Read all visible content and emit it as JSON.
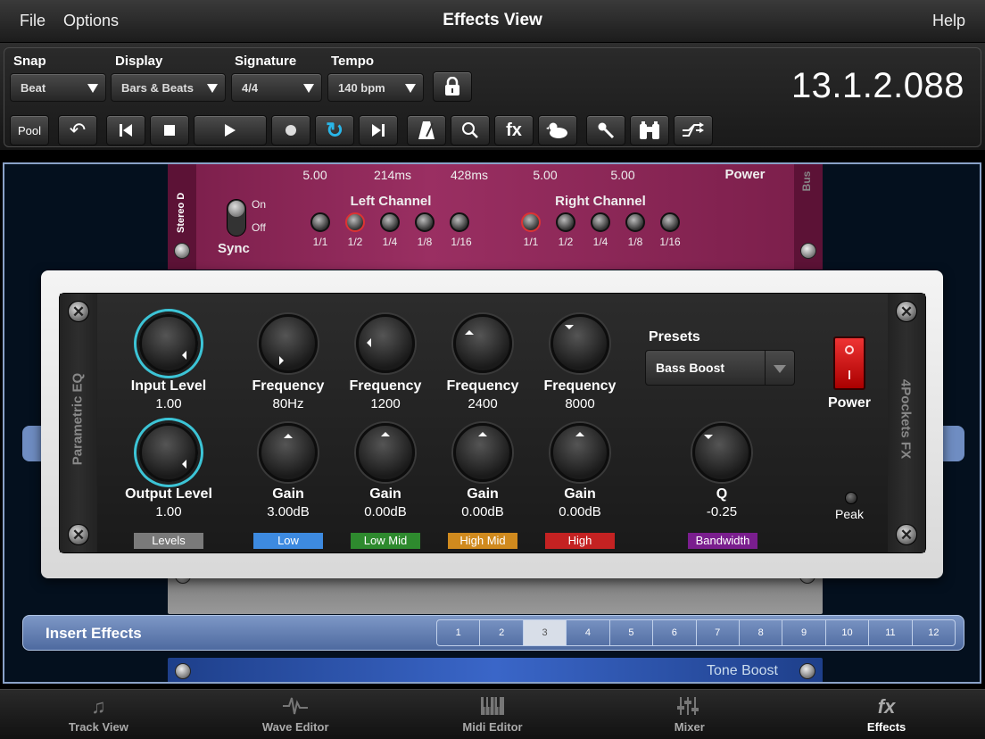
{
  "titlebar": {
    "menu_file": "File",
    "menu_options": "Options",
    "title": "Effects View",
    "help": "Help"
  },
  "toolbar": {
    "snap_label": "Snap",
    "snap_value": "Beat",
    "display_label": "Display",
    "display_value": "Bars & Beats",
    "signature_label": "Signature",
    "signature_value": "4/4",
    "tempo_label": "Tempo",
    "tempo_value": "140 bpm",
    "pool_label": "Pool",
    "fx_label": "fx",
    "timecode": "13.1.2.088"
  },
  "delay": {
    "values": [
      "5.00",
      "214ms",
      "428ms",
      "5.00",
      "5.00"
    ],
    "power": "Power",
    "bus": "Bus",
    "side_label": "Stereo D",
    "left_channel": "Left Channel",
    "right_channel": "Right Channel",
    "sync": "Sync",
    "on": "On",
    "off": "Off",
    "notes": [
      "1/1",
      "1/2",
      "1/4",
      "1/8",
      "1/16"
    ]
  },
  "eq": {
    "side_title": "Parametric EQ",
    "brand": "4Pockets FX",
    "input_level_label": "Input Level",
    "input_level_value": "1.00",
    "output_level_label": "Output Level",
    "output_level_value": "1.00",
    "freq_label": "Frequency",
    "freq_low": "80Hz",
    "freq_lowmid": "1200",
    "freq_highmid": "2400",
    "freq_high": "8000",
    "gain_label": "Gain",
    "gain_low": "3.00dB",
    "gain_lowmid": "0.00dB",
    "gain_highmid": "0.00dB",
    "gain_high": "0.00dB",
    "q_label": "Q",
    "q_value": "-0.25",
    "presets_label": "Presets",
    "preset_value": "Bass Boost",
    "power_label": "Power",
    "peak_label": "Peak",
    "tags": {
      "levels": "Levels",
      "low": "Low",
      "low_mid": "Low Mid",
      "high_mid": "High Mid",
      "high": "High",
      "bandwidth": "Bandwidth"
    },
    "tag_colors": {
      "levels": "#7a7a7a",
      "low": "#3d8ae0",
      "low_mid": "#2e8a2e",
      "high_mid": "#d08a1e",
      "high": "#c42222",
      "bandwidth": "#7a1e8e"
    },
    "ring_color": "#3cc4d6"
  },
  "insert": {
    "label": "Insert Effects",
    "slots": [
      "1",
      "2",
      "3",
      "4",
      "5",
      "6",
      "7",
      "8",
      "9",
      "10",
      "11",
      "12"
    ],
    "active_slot": "3"
  },
  "toneboost": {
    "label": "Tone Boost"
  },
  "tabs": [
    {
      "label": "Track View",
      "icon": "music-note-icon"
    },
    {
      "label": "Wave Editor",
      "icon": "waveform-icon"
    },
    {
      "label": "Midi Editor",
      "icon": "piano-keys-icon"
    },
    {
      "label": "Mixer",
      "icon": "mixer-faders-icon"
    },
    {
      "label": "Effects",
      "icon": "fx-icon"
    }
  ],
  "tab_effects_icon_text": "fx"
}
